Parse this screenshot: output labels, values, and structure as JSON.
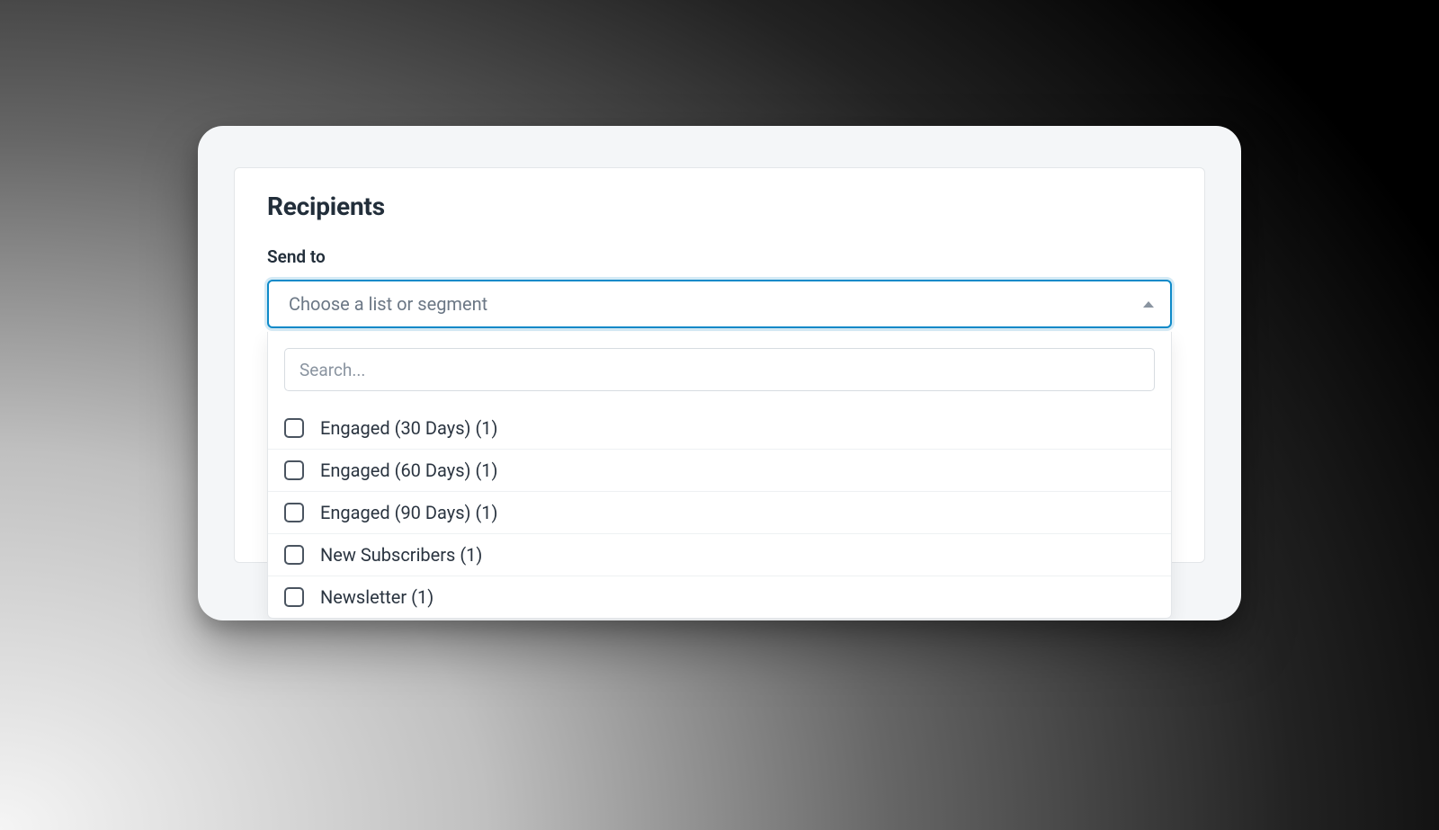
{
  "section": {
    "title": "Recipients",
    "field_label": "Send to"
  },
  "dropdown": {
    "placeholder": "Choose a list or segment",
    "search_placeholder": "Search...",
    "options": [
      {
        "label": "Engaged (30 Days) (1)"
      },
      {
        "label": "Engaged (60 Days) (1)"
      },
      {
        "label": "Engaged (90 Days) (1)"
      },
      {
        "label": "New Subscribers (1)"
      },
      {
        "label": "Newsletter (1)"
      }
    ]
  }
}
